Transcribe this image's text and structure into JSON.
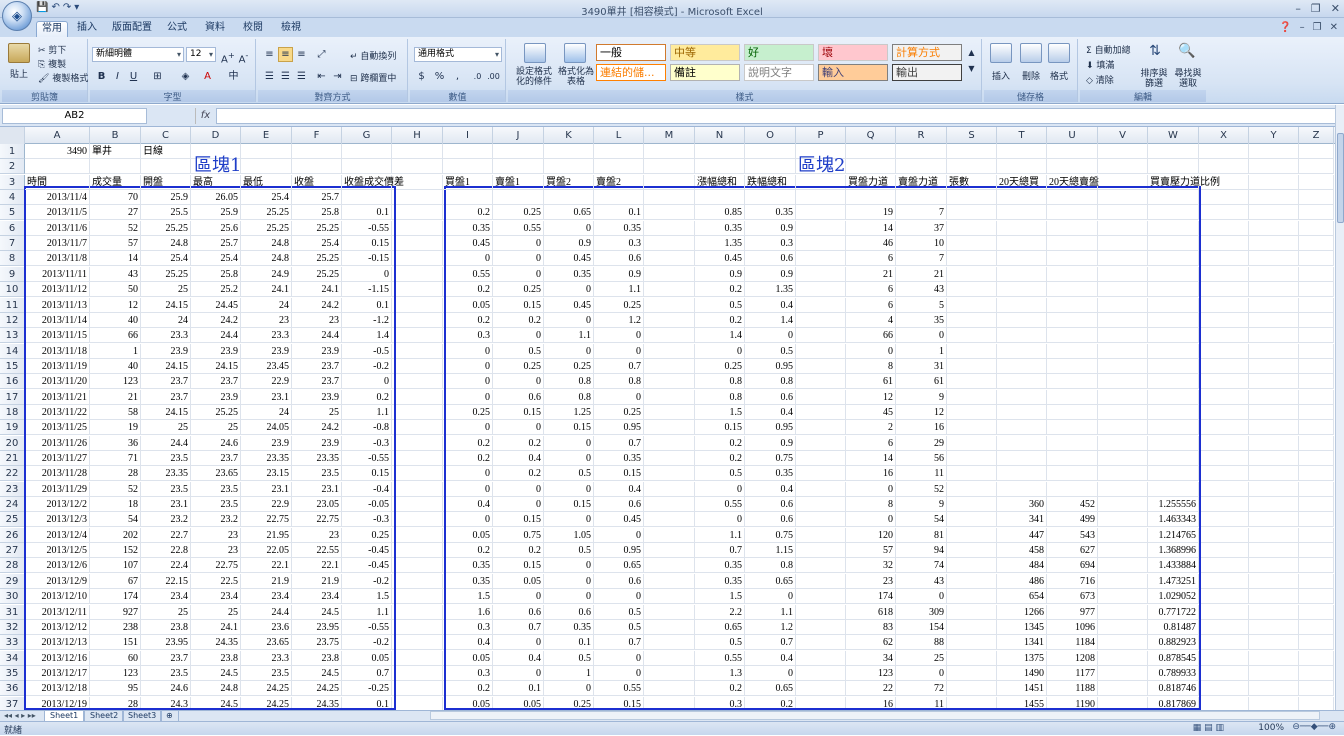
{
  "window": {
    "title": "3490單井 [相容模式] - Microsoft Excel"
  },
  "tabs": [
    "常用",
    "插入",
    "版面配置",
    "公式",
    "資料",
    "校閱",
    "檢視"
  ],
  "ribbon": {
    "clipboard": {
      "paste": "貼上",
      "cut": "剪下",
      "copy": "複製",
      "format_painter": "複製格式",
      "label": "剪貼簿"
    },
    "font": {
      "name": "新細明體",
      "size": "12",
      "label": "字型"
    },
    "alignment": {
      "wrap": "自動換列",
      "merge": "跨欄置中",
      "label": "對齊方式"
    },
    "number": {
      "format": "通用格式",
      "label": "數值"
    },
    "styles": {
      "conditional": "設定格式化的條件",
      "as_table": "格式化為表格",
      "items": [
        {
          "text": "一般",
          "bg": "#ffffff",
          "color": "#000000",
          "border": "#d07a2e"
        },
        {
          "text": "中等",
          "bg": "#ffeb9c",
          "color": "#9c6500",
          "border": "#c9c9c9"
        },
        {
          "text": "好",
          "bg": "#c6efce",
          "color": "#006100",
          "border": "#c9c9c9"
        },
        {
          "text": "壞",
          "bg": "#ffc7ce",
          "color": "#9c0006",
          "border": "#c9c9c9"
        },
        {
          "text": "計算方式",
          "bg": "#f2f2f2",
          "color": "#fa7d00",
          "border": "#7f7f7f"
        },
        {
          "text": "連結的儲...",
          "bg": "#ffffff",
          "color": "#fa7d00",
          "border": "#ff8001"
        },
        {
          "text": "備註",
          "bg": "#ffffcc",
          "color": "#000000",
          "border": "#b2b2b2"
        },
        {
          "text": "說明文字",
          "bg": "#ffffff",
          "color": "#7f7f7f",
          "border": "#c9c9c9"
        },
        {
          "text": "輸入",
          "bg": "#ffcc99",
          "color": "#3f3f76",
          "border": "#7f7f7f"
        },
        {
          "text": "輸出",
          "bg": "#f2f2f2",
          "color": "#3f3f3f",
          "border": "#3f3f3f"
        }
      ],
      "label": "樣式"
    },
    "cells": {
      "insert": "插入",
      "delete": "刪除",
      "format": "格式",
      "label": "儲存格"
    },
    "editing": {
      "autosum": "自動加總",
      "fill": "填滿",
      "clear": "清除",
      "sort": "排序與篩選",
      "find": "尋找與選取",
      "label": "編輯"
    }
  },
  "formula_bar": {
    "name_box": "AB2",
    "fx": "fx",
    "value": ""
  },
  "columns": [
    "A",
    "B",
    "C",
    "D",
    "E",
    "F",
    "G",
    "H",
    "I",
    "J",
    "K",
    "L",
    "M",
    "N",
    "O",
    "P",
    "Q",
    "R",
    "S",
    "T",
    "U",
    "V",
    "W",
    "X",
    "Y",
    "Z"
  ],
  "sheet": {
    "row1": {
      "A": "3490",
      "B": "單井",
      "C": "日線"
    },
    "block1_title": "區塊1",
    "block2_title": "區塊2",
    "headers": {
      "A": "時間",
      "B": "成交量",
      "C": "開盤",
      "D": "最高",
      "E": "最低",
      "F": "收盤",
      "G": "收盤成交價差",
      "I": "買盤1",
      "J": "賣盤1",
      "K": "買盤2",
      "L": "賣盤2",
      "N": "漲幅總和",
      "O": "跌幅總和",
      "Q": "買盤力道",
      "R": "賣盤力道",
      "S": "張數",
      "T": "20天總買",
      "U": "20天總賣盤",
      "W": "買賣壓力道比例"
    },
    "rows": [
      {
        "n": 4,
        "A": "2013/11/4",
        "B": "70",
        "C": "25.9",
        "D": "26.05",
        "E": "25.4",
        "F": "25.7",
        "G": "",
        "I": "",
        "J": "",
        "K": "",
        "L": "",
        "N": "",
        "O": "",
        "Q": "",
        "R": "",
        "T": "",
        "U": "",
        "W": ""
      },
      {
        "n": 5,
        "A": "2013/11/5",
        "B": "27",
        "C": "25.5",
        "D": "25.9",
        "E": "25.25",
        "F": "25.8",
        "G": "0.1",
        "I": "0.2",
        "J": "0.25",
        "K": "0.65",
        "L": "0.1",
        "N": "0.85",
        "O": "0.35",
        "Q": "19",
        "R": "7",
        "T": "",
        "U": "",
        "W": ""
      },
      {
        "n": 6,
        "A": "2013/11/6",
        "B": "52",
        "C": "25.25",
        "D": "25.6",
        "E": "25.25",
        "F": "25.25",
        "G": "-0.55",
        "I": "0.35",
        "J": "0.55",
        "K": "0",
        "L": "0.35",
        "N": "0.35",
        "O": "0.9",
        "Q": "14",
        "R": "37",
        "T": "",
        "U": "",
        "W": ""
      },
      {
        "n": 7,
        "A": "2013/11/7",
        "B": "57",
        "C": "24.8",
        "D": "25.7",
        "E": "24.8",
        "F": "25.4",
        "G": "0.15",
        "I": "0.45",
        "J": "0",
        "K": "0.9",
        "L": "0.3",
        "N": "1.35",
        "O": "0.3",
        "Q": "46",
        "R": "10",
        "T": "",
        "U": "",
        "W": ""
      },
      {
        "n": 8,
        "A": "2013/11/8",
        "B": "14",
        "C": "25.4",
        "D": "25.4",
        "E": "24.8",
        "F": "25.25",
        "G": "-0.15",
        "I": "0",
        "J": "0",
        "K": "0.45",
        "L": "0.6",
        "N": "0.45",
        "O": "0.6",
        "Q": "6",
        "R": "7",
        "T": "",
        "U": "",
        "W": ""
      },
      {
        "n": 9,
        "A": "2013/11/11",
        "B": "43",
        "C": "25.25",
        "D": "25.8",
        "E": "24.9",
        "F": "25.25",
        "G": "0",
        "I": "0.55",
        "J": "0",
        "K": "0.35",
        "L": "0.9",
        "N": "0.9",
        "O": "0.9",
        "Q": "21",
        "R": "21",
        "T": "",
        "U": "",
        "W": ""
      },
      {
        "n": 10,
        "A": "2013/11/12",
        "B": "50",
        "C": "25",
        "D": "25.2",
        "E": "24.1",
        "F": "24.1",
        "G": "-1.15",
        "I": "0.2",
        "J": "0.25",
        "K": "0",
        "L": "1.1",
        "N": "0.2",
        "O": "1.35",
        "Q": "6",
        "R": "43",
        "T": "",
        "U": "",
        "W": ""
      },
      {
        "n": 11,
        "A": "2013/11/13",
        "B": "12",
        "C": "24.15",
        "D": "24.45",
        "E": "24",
        "F": "24.2",
        "G": "0.1",
        "I": "0.05",
        "J": "0.15",
        "K": "0.45",
        "L": "0.25",
        "N": "0.5",
        "O": "0.4",
        "Q": "6",
        "R": "5",
        "T": "",
        "U": "",
        "W": ""
      },
      {
        "n": 12,
        "A": "2013/11/14",
        "B": "40",
        "C": "24",
        "D": "24.2",
        "E": "23",
        "F": "23",
        "G": "-1.2",
        "I": "0.2",
        "J": "0.2",
        "K": "0",
        "L": "1.2",
        "N": "0.2",
        "O": "1.4",
        "Q": "4",
        "R": "35",
        "T": "",
        "U": "",
        "W": ""
      },
      {
        "n": 13,
        "A": "2013/11/15",
        "B": "66",
        "C": "23.3",
        "D": "24.4",
        "E": "23.3",
        "F": "24.4",
        "G": "1.4",
        "I": "0.3",
        "J": "0",
        "K": "1.1",
        "L": "0",
        "N": "1.4",
        "O": "0",
        "Q": "66",
        "R": "0",
        "T": "",
        "U": "",
        "W": ""
      },
      {
        "n": 14,
        "A": "2013/11/18",
        "B": "1",
        "C": "23.9",
        "D": "23.9",
        "E": "23.9",
        "F": "23.9",
        "G": "-0.5",
        "I": "0",
        "J": "0.5",
        "K": "0",
        "L": "0",
        "N": "0",
        "O": "0.5",
        "Q": "0",
        "R": "1",
        "T": "",
        "U": "",
        "W": ""
      },
      {
        "n": 15,
        "A": "2013/11/19",
        "B": "40",
        "C": "24.15",
        "D": "24.15",
        "E": "23.45",
        "F": "23.7",
        "G": "-0.2",
        "I": "0",
        "J": "0.25",
        "K": "0.25",
        "L": "0.7",
        "N": "0.25",
        "O": "0.95",
        "Q": "8",
        "R": "31",
        "T": "",
        "U": "",
        "W": ""
      },
      {
        "n": 16,
        "A": "2013/11/20",
        "B": "123",
        "C": "23.7",
        "D": "23.7",
        "E": "22.9",
        "F": "23.7",
        "G": "0",
        "I": "0",
        "J": "0",
        "K": "0.8",
        "L": "0.8",
        "N": "0.8",
        "O": "0.8",
        "Q": "61",
        "R": "61",
        "T": "",
        "U": "",
        "W": ""
      },
      {
        "n": 17,
        "A": "2013/11/21",
        "B": "21",
        "C": "23.7",
        "D": "23.9",
        "E": "23.1",
        "F": "23.9",
        "G": "0.2",
        "I": "0",
        "J": "0.6",
        "K": "0.8",
        "L": "0",
        "N": "0.8",
        "O": "0.6",
        "Q": "12",
        "R": "9",
        "T": "",
        "U": "",
        "W": ""
      },
      {
        "n": 18,
        "A": "2013/11/22",
        "B": "58",
        "C": "24.15",
        "D": "25.25",
        "E": "24",
        "F": "25",
        "G": "1.1",
        "I": "0.25",
        "J": "0.15",
        "K": "1.25",
        "L": "0.25",
        "N": "1.5",
        "O": "0.4",
        "Q": "45",
        "R": "12",
        "T": "",
        "U": "",
        "W": ""
      },
      {
        "n": 19,
        "A": "2013/11/25",
        "B": "19",
        "C": "25",
        "D": "25",
        "E": "24.05",
        "F": "24.2",
        "G": "-0.8",
        "I": "0",
        "J": "0",
        "K": "0.15",
        "L": "0.95",
        "N": "0.15",
        "O": "0.95",
        "Q": "2",
        "R": "16",
        "T": "",
        "U": "",
        "W": ""
      },
      {
        "n": 20,
        "A": "2013/11/26",
        "B": "36",
        "C": "24.4",
        "D": "24.6",
        "E": "23.9",
        "F": "23.9",
        "G": "-0.3",
        "I": "0.2",
        "J": "0.2",
        "K": "0",
        "L": "0.7",
        "N": "0.2",
        "O": "0.9",
        "Q": "6",
        "R": "29",
        "T": "",
        "U": "",
        "W": ""
      },
      {
        "n": 21,
        "A": "2013/11/27",
        "B": "71",
        "C": "23.5",
        "D": "23.7",
        "E": "23.35",
        "F": "23.35",
        "G": "-0.55",
        "I": "0.2",
        "J": "0.4",
        "K": "0",
        "L": "0.35",
        "N": "0.2",
        "O": "0.75",
        "Q": "14",
        "R": "56",
        "T": "",
        "U": "",
        "W": ""
      },
      {
        "n": 22,
        "A": "2013/11/28",
        "B": "28",
        "C": "23.35",
        "D": "23.65",
        "E": "23.15",
        "F": "23.5",
        "G": "0.15",
        "I": "0",
        "J": "0.2",
        "K": "0.5",
        "L": "0.15",
        "N": "0.5",
        "O": "0.35",
        "Q": "16",
        "R": "11",
        "T": "",
        "U": "",
        "W": ""
      },
      {
        "n": 23,
        "A": "2013/11/29",
        "B": "52",
        "C": "23.5",
        "D": "23.5",
        "E": "23.1",
        "F": "23.1",
        "G": "-0.4",
        "I": "0",
        "J": "0",
        "K": "0",
        "L": "0.4",
        "N": "0",
        "O": "0.4",
        "Q": "0",
        "R": "52",
        "T": "",
        "U": "",
        "W": ""
      },
      {
        "n": 24,
        "A": "2013/12/2",
        "B": "18",
        "C": "23.1",
        "D": "23.5",
        "E": "22.9",
        "F": "23.05",
        "G": "-0.05",
        "I": "0.4",
        "J": "0",
        "K": "0.15",
        "L": "0.6",
        "N": "0.55",
        "O": "0.6",
        "Q": "8",
        "R": "9",
        "T": "360",
        "U": "452",
        "W": "1.255556"
      },
      {
        "n": 25,
        "A": "2013/12/3",
        "B": "54",
        "C": "23.2",
        "D": "23.2",
        "E": "22.75",
        "F": "22.75",
        "G": "-0.3",
        "I": "0",
        "J": "0.15",
        "K": "0",
        "L": "0.45",
        "N": "0",
        "O": "0.6",
        "Q": "0",
        "R": "54",
        "T": "341",
        "U": "499",
        "W": "1.463343"
      },
      {
        "n": 26,
        "A": "2013/12/4",
        "B": "202",
        "C": "22.7",
        "D": "23",
        "E": "21.95",
        "F": "23",
        "G": "0.25",
        "I": "0.05",
        "J": "0.75",
        "K": "1.05",
        "L": "0",
        "N": "1.1",
        "O": "0.75",
        "Q": "120",
        "R": "81",
        "T": "447",
        "U": "543",
        "W": "1.214765"
      },
      {
        "n": 27,
        "A": "2013/12/5",
        "B": "152",
        "C": "22.8",
        "D": "23",
        "E": "22.05",
        "F": "22.55",
        "G": "-0.45",
        "I": "0.2",
        "J": "0.2",
        "K": "0.5",
        "L": "0.95",
        "N": "0.7",
        "O": "1.15",
        "Q": "57",
        "R": "94",
        "T": "458",
        "U": "627",
        "W": "1.368996"
      },
      {
        "n": 28,
        "A": "2013/12/6",
        "B": "107",
        "C": "22.4",
        "D": "22.75",
        "E": "22.1",
        "F": "22.1",
        "G": "-0.45",
        "I": "0.35",
        "J": "0.15",
        "K": "0",
        "L": "0.65",
        "N": "0.35",
        "O": "0.8",
        "Q": "32",
        "R": "74",
        "T": "484",
        "U": "694",
        "W": "1.433884"
      },
      {
        "n": 29,
        "A": "2013/12/9",
        "B": "67",
        "C": "22.15",
        "D": "22.5",
        "E": "21.9",
        "F": "21.9",
        "G": "-0.2",
        "I": "0.35",
        "J": "0.05",
        "K": "0",
        "L": "0.6",
        "N": "0.35",
        "O": "0.65",
        "Q": "23",
        "R": "43",
        "T": "486",
        "U": "716",
        "W": "1.473251"
      },
      {
        "n": 30,
        "A": "2013/12/10",
        "B": "174",
        "C": "23.4",
        "D": "23.4",
        "E": "23.4",
        "F": "23.4",
        "G": "1.5",
        "I": "1.5",
        "J": "0",
        "K": "0",
        "L": "0",
        "N": "1.5",
        "O": "0",
        "Q": "174",
        "R": "0",
        "T": "654",
        "U": "673",
        "W": "1.029052"
      },
      {
        "n": 31,
        "A": "2013/12/11",
        "B": "927",
        "C": "25",
        "D": "25",
        "E": "24.4",
        "F": "24.5",
        "G": "1.1",
        "I": "1.6",
        "J": "0.6",
        "K": "0.6",
        "L": "0.5",
        "N": "2.2",
        "O": "1.1",
        "Q": "618",
        "R": "309",
        "T": "1266",
        "U": "977",
        "W": "0.771722"
      },
      {
        "n": 32,
        "A": "2013/12/12",
        "B": "238",
        "C": "23.8",
        "D": "24.1",
        "E": "23.6",
        "F": "23.95",
        "G": "-0.55",
        "I": "0.3",
        "J": "0.7",
        "K": "0.35",
        "L": "0.5",
        "N": "0.65",
        "O": "1.2",
        "Q": "83",
        "R": "154",
        "T": "1345",
        "U": "1096",
        "W": "0.81487"
      },
      {
        "n": 33,
        "A": "2013/12/13",
        "B": "151",
        "C": "23.95",
        "D": "24.35",
        "E": "23.65",
        "F": "23.75",
        "G": "-0.2",
        "I": "0.4",
        "J": "0",
        "K": "0.1",
        "L": "0.7",
        "N": "0.5",
        "O": "0.7",
        "Q": "62",
        "R": "88",
        "T": "1341",
        "U": "1184",
        "W": "0.882923"
      },
      {
        "n": 34,
        "A": "2013/12/16",
        "B": "60",
        "C": "23.7",
        "D": "23.8",
        "E": "23.3",
        "F": "23.8",
        "G": "0.05",
        "I": "0.05",
        "J": "0.4",
        "K": "0.5",
        "L": "0",
        "N": "0.55",
        "O": "0.4",
        "Q": "34",
        "R": "25",
        "T": "1375",
        "U": "1208",
        "W": "0.878545"
      },
      {
        "n": 35,
        "A": "2013/12/17",
        "B": "123",
        "C": "23.5",
        "D": "24.5",
        "E": "23.5",
        "F": "24.5",
        "G": "0.7",
        "I": "0.3",
        "J": "0",
        "K": "1",
        "L": "0",
        "N": "1.3",
        "O": "0",
        "Q": "123",
        "R": "0",
        "T": "1490",
        "U": "1177",
        "W": "0.789933"
      },
      {
        "n": 36,
        "A": "2013/12/18",
        "B": "95",
        "C": "24.6",
        "D": "24.8",
        "E": "24.25",
        "F": "24.25",
        "G": "-0.25",
        "I": "0.2",
        "J": "0.1",
        "K": "0",
        "L": "0.55",
        "N": "0.2",
        "O": "0.65",
        "Q": "22",
        "R": "72",
        "T": "1451",
        "U": "1188",
        "W": "0.818746"
      },
      {
        "n": 37,
        "A": "2013/12/19",
        "B": "28",
        "C": "24.3",
        "D": "24.5",
        "E": "24.25",
        "F": "24.35",
        "G": "0.1",
        "I": "0.05",
        "J": "0.05",
        "K": "0.25",
        "L": "0.15",
        "N": "0.3",
        "O": "0.2",
        "Q": "16",
        "R": "11",
        "T": "1455",
        "U": "1190",
        "W": "0.817869"
      }
    ]
  },
  "sheet_tabs": [
    "Sheet1",
    "Sheet2",
    "Sheet3"
  ],
  "status": {
    "ready": "就緒",
    "zoom": "100%"
  }
}
